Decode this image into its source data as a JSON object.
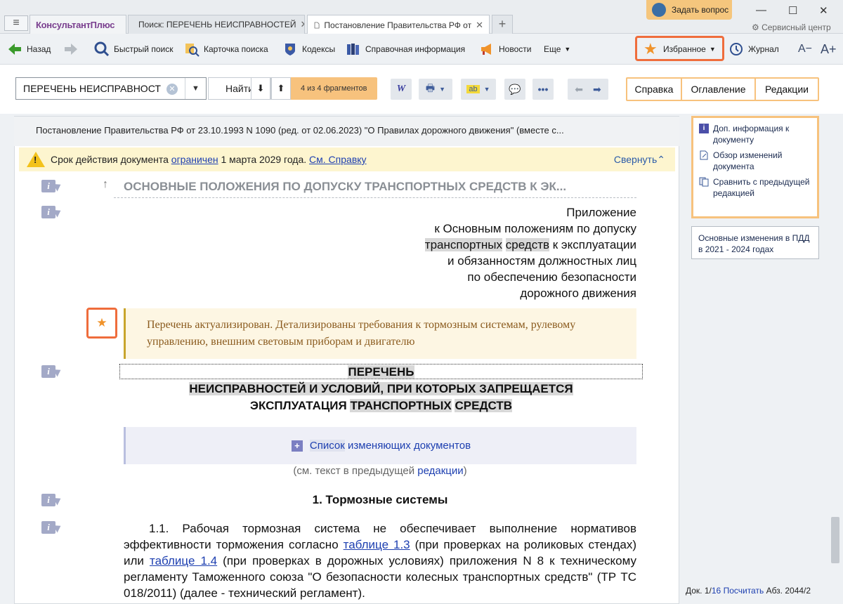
{
  "window": {
    "brand": "КонсультантПлюс",
    "tabs": [
      {
        "label": "Поиск: ПЕРЕЧЕНЬ НЕИСПРАВНОСТЕЙ"
      },
      {
        "label": "Постановление Правительства РФ от"
      }
    ],
    "ask_button": "Задать вопрос",
    "service_center": "Сервисный центр",
    "controls": {
      "minimize": "—",
      "maximize": "☐",
      "close": "✕"
    }
  },
  "toolbar": {
    "back": "Назад",
    "quick_search": "Быстрый поиск",
    "search_card": "Карточка поиска",
    "codes": "Кодексы",
    "reference": "Справочная информация",
    "news": "Новости",
    "more": "Еще",
    "favorites": "Избранное",
    "journal": "Журнал",
    "font_smaller": "A−",
    "font_larger": "A+"
  },
  "search": {
    "value": "ПЕРЕЧЕНЬ НЕИСПРАВНОСТ",
    "find_label": "Найти",
    "fragments": "4 из 4 фрагментов"
  },
  "right_tabs": [
    "Справка",
    "Оглавление",
    "Редакции"
  ],
  "document": {
    "title": "Постановление Правительства РФ от 23.10.1993 N 1090 (ред. от 02.06.2023) \"О Правилах дорожного движения\" (вместе с...",
    "warning": {
      "prefix": "Срок действия документа ",
      "link": "ограничен",
      "middle": " 1 марта 2029 года. ",
      "link2": "См. Справку",
      "collapse": "Свернуть"
    },
    "section_heading": "ОСНОВНЫЕ ПОЛОЖЕНИЯ ПО ДОПУСКУ ТРАНСПОРТНЫХ СРЕДСТВ К ЭК...",
    "appendix": {
      "l1": "Приложение",
      "l2": "к Основным положениям по допуску",
      "l3a": "транспортных",
      "l3b": "средств",
      "l3c": " к эксплуатации",
      "l4": "и обязанностям должностных лиц",
      "l5": "по обеспечению безопасности",
      "l6": "дорожного движения"
    },
    "note": "Перечень актуализирован. Детализированы требования к тормозным системам, рулевому управлению, внешним световым приборам и двигателю",
    "main_title": {
      "l1": "ПЕРЕЧЕНЬ",
      "l2": "НЕИСПРАВНОСТЕЙ И УСЛОВИЙ, ПРИ КОТОРЫХ ЗАПРЕЩАЕТСЯ",
      "l3a": "ЭКСПЛУАТАЦИЯ ",
      "l3b": "ТРАНСПОРТНЫХ",
      "l3c": "СРЕДСТВ"
    },
    "changes_list": {
      "a": "Список",
      "b": " изменяющих документов"
    },
    "prev_text": {
      "a": "(см. текст в предыдущей ",
      "b": "редакции",
      "c": ")"
    },
    "section1": "1. Тормозные системы",
    "para": {
      "a": "1.1. Рабочая тормозная система не обеспечивает выполнение нормативов эффективности торможения согласно ",
      "link1": "таблице 1.3",
      "b": " (при проверках на роликовых стендах) или ",
      "link2": "таблице 1.4",
      "c": " (при проверках в дорожных условиях) приложения N 8 к техническому регламенту Таможенного союза \"О безопасности колесных транспортных средств\" (ТР ТС 018/2011) (далее - технический регламент)."
    }
  },
  "sidebar": {
    "items": [
      {
        "label": "Доп. информация к документу"
      },
      {
        "label": "Обзор изменений документа"
      },
      {
        "label": "Сравнить с предыдущей редакцией"
      }
    ],
    "box2": "Основные изменения в ПДД в 2021 - 2024 годах"
  },
  "status": {
    "doc": "Док. 1/",
    "doc_total": "16",
    "count": "Посчитать",
    "abz": "Абз. 2044/2"
  },
  "colors": {
    "accent": "#f7c27d",
    "highlight": "#ef6d3c",
    "link": "#1d3fb0",
    "warning_bg": "#fdf5cf"
  }
}
